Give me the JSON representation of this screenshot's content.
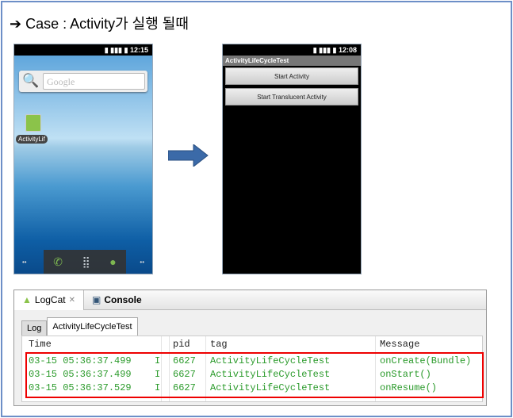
{
  "title": "➔ Case : Activity가 실행 될때",
  "phone_home": {
    "time": "12:15",
    "search_placeholder": "Google",
    "app_label": "ActivityLif"
  },
  "phone_app": {
    "time": "12:08",
    "app_title": "ActivityLifeCycleTest",
    "buttons": [
      "Start Activity",
      "Start Translucent Activity"
    ]
  },
  "logcat": {
    "view_tabs": [
      "LogCat",
      "Console"
    ],
    "sub_tabs": [
      "Log",
      "ActivityLifeCycleTest"
    ],
    "columns": [
      "Time",
      "",
      "pid",
      "tag",
      "Message"
    ],
    "rows": [
      {
        "time": "03-15 05:36:37.499",
        "level": "I",
        "pid": "6627",
        "tag": "ActivityLifeCycleTest",
        "message": "onCreate(Bundle)"
      },
      {
        "time": "03-15 05:36:37.499",
        "level": "I",
        "pid": "6627",
        "tag": "ActivityLifeCycleTest",
        "message": "onStart()"
      },
      {
        "time": "03-15 05:36:37.529",
        "level": "I",
        "pid": "6627",
        "tag": "ActivityLifeCycleTest",
        "message": "onResume()"
      }
    ]
  },
  "colors": {
    "log_text": "#2a9a2a",
    "highlight": "#e00000",
    "arrow": "#3b6aa8"
  }
}
